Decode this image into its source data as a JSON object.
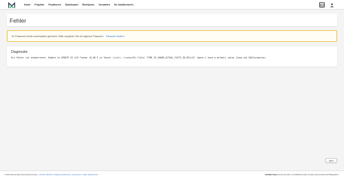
{
  "nav": {
    "items": [
      {
        "label": "Karte"
      },
      {
        "label": "Projekte"
      },
      {
        "label": "Positionen"
      },
      {
        "label": "Dashboard"
      },
      {
        "label": "Richtpreis"
      },
      {
        "label": "Verwalten"
      },
      {
        "label": "So funktioniert's"
      }
    ]
  },
  "header": {
    "title": "Fehler"
  },
  "alert": {
    "text": "Ihr Passwort wurde automatisch generiert. Bitte vergeben Sie ein eigenes Passwort.",
    "link": "Passwort ändern"
  },
  "diagnostic": {
    "title": "Diagnostic",
    "message": "Ein Fehler ist aufgetreten: Unable to UPDATE 01 419 Tonnen (0,00 € je Tonne) (List): (<conn>25) Field 'TIME_TO_SHAME_ACTUAL_FACTS_IN_MILLIS' doesn't have a default value (Java.sql.SQLException)"
  },
  "help": {
    "label": "Hilfe?"
  },
  "footer": {
    "left_text": "© 2024 Marmal Werk Deutschland GmbH •",
    "links": [
      "+49 521 2303 50",
      "info@marmalwerk.de",
      "Impressum",
      "AGB",
      "Datenschutz"
    ],
    "right_bold": "Infotafel Suisa",
    "right_text": "(Suisa Test #41): eF729a53fee0 (48) of Pawee http://localhost:8078/app/ifb/1"
  },
  "colors": {
    "accent": "#3b7fd6",
    "alert_border": "#f2c14e",
    "alert_bg": "#fffdf4",
    "logo_green": "#2fb26a",
    "logo_dark": "#2d3e50"
  },
  "icons": [
    "logo-icon",
    "server-icon",
    "user-icon"
  ]
}
